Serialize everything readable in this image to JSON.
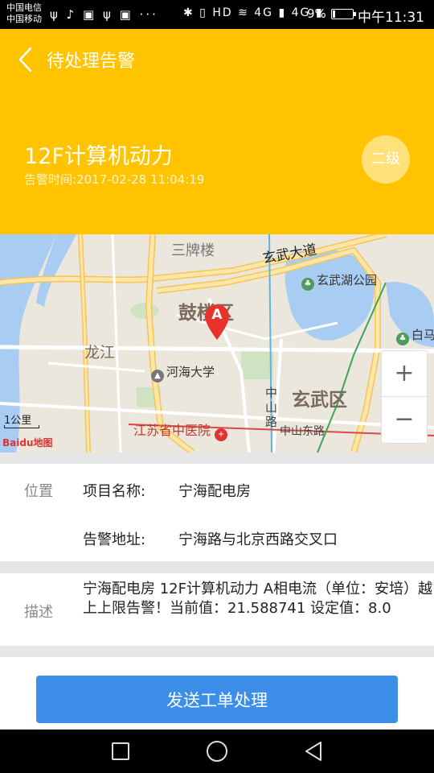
{
  "status_bar": {
    "carrier_1": "中国电信",
    "carrier_2": "中国移动",
    "left_icons": "ψ ♪ ▣ ψ ▣ ···",
    "right_icons": "✱ ▯ HD ≋ 4G ▮ 4G ▮",
    "battery": "9%",
    "time": "中午11:31"
  },
  "header": {
    "back_icon": "chevron-left-icon",
    "title": "待处理告警",
    "alarm_title": "12F计算机动力",
    "alarm_time_label": "告警时间:",
    "alarm_time_value": "2017-02-28 11:04:19",
    "level": "二级",
    "background": "#ffc300"
  },
  "map": {
    "districts": [
      "鼓楼区",
      "玄武区"
    ],
    "road_labels": [
      "三牌楼",
      "玄武大道",
      "龙江",
      "中山东路"
    ],
    "vertical_road": [
      "中",
      "山",
      "路"
    ],
    "pois": [
      "玄武湖公园",
      "河海大学",
      "白马"
    ],
    "hospital": "江苏省中医院",
    "marker_label": "A",
    "zoom_in": "+",
    "zoom_out": "−",
    "scale": "1公里",
    "logo": "Baidu地图"
  },
  "location": {
    "section_label": "位置",
    "project_name_label": "项目名称:",
    "project_name_value": "宁海配电房",
    "address_label": "告警地址:",
    "address_value": "宁海路与北京西路交叉口"
  },
  "description": {
    "section_label": "描述",
    "text": "宁海配电房 12F计算机动力 A相电流（单位：安培）越上上限告警！当前值：21.588741 设定值：8.0"
  },
  "action": {
    "send_button": "发送工单处理",
    "color": "#3d8ee8"
  },
  "nav": {
    "recent_icon": "square-icon",
    "home_icon": "circle-icon",
    "back_icon": "triangle-back-icon"
  }
}
